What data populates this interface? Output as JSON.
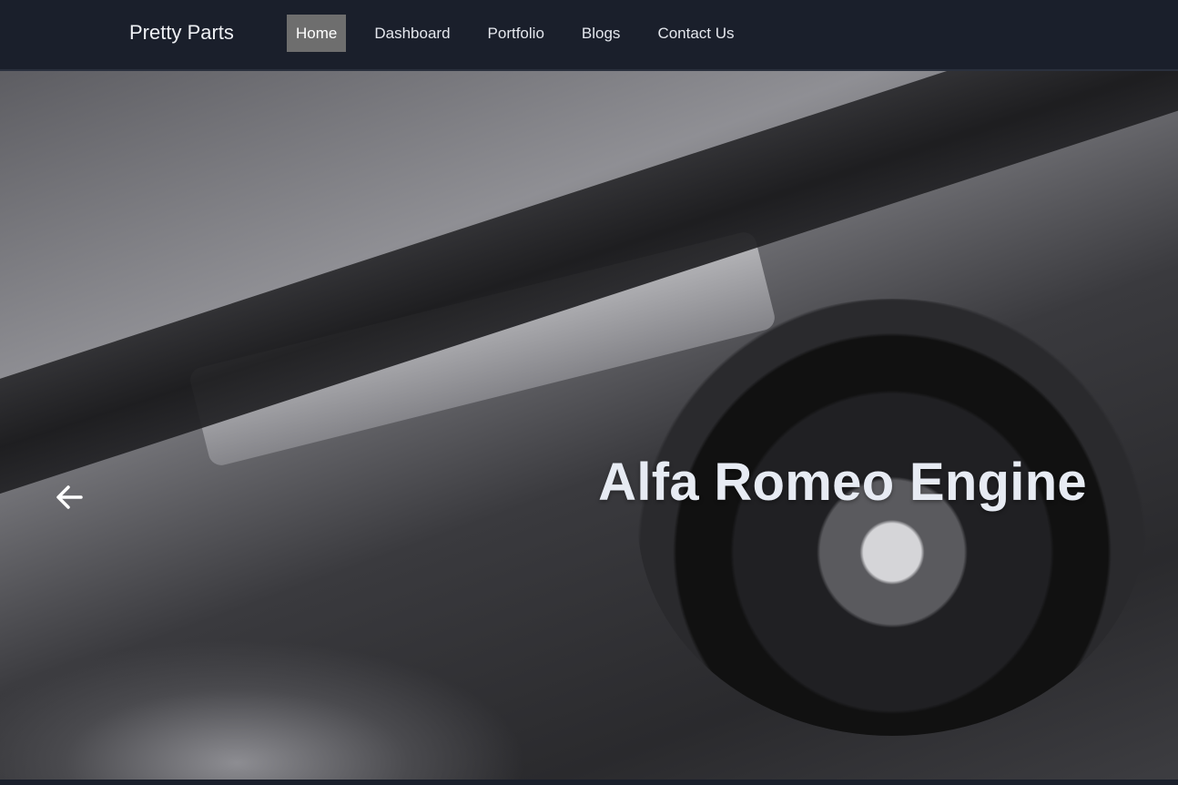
{
  "navbar": {
    "brand": "Pretty Parts",
    "items": [
      {
        "label": "Home",
        "active": true
      },
      {
        "label": "Dashboard",
        "active": false
      },
      {
        "label": "Portfolio",
        "active": false
      },
      {
        "label": "Blogs",
        "active": false
      },
      {
        "label": "Contact Us",
        "active": false
      }
    ]
  },
  "carousel": {
    "caption": "Alfa Romeo Engine",
    "prev_icon": "arrow-left-icon"
  },
  "colors": {
    "navbar_bg": "#1a1f2b",
    "active_nav_bg": "#6e6e6e",
    "caption_text": "#e7ebf3"
  }
}
